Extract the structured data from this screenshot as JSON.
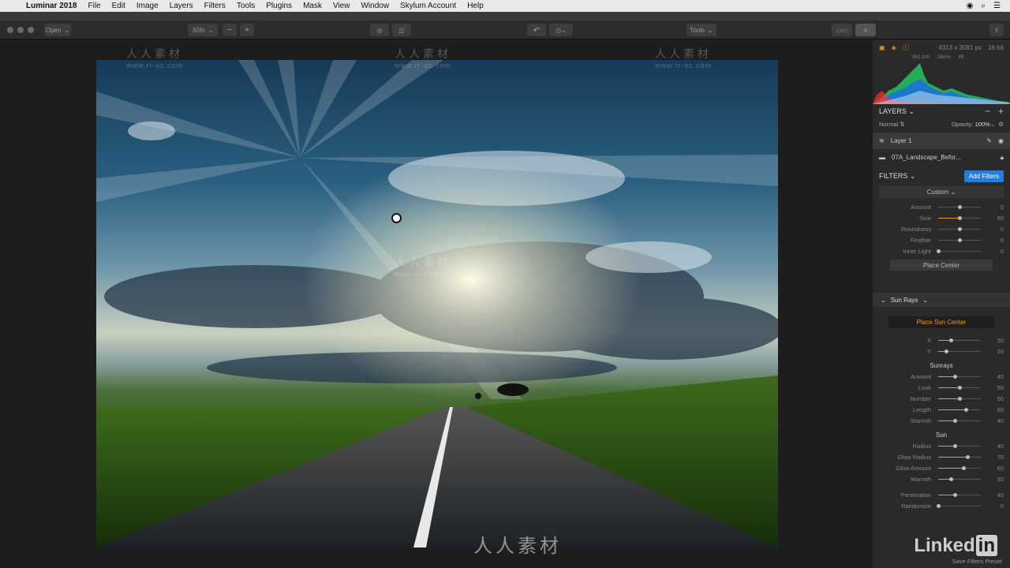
{
  "menubar": {
    "app": "Luminar 2018",
    "items": [
      "File",
      "Edit",
      "Image",
      "Layers",
      "Filters",
      "Tools",
      "Plugins",
      "Mask",
      "View",
      "Window",
      "Skylum Account",
      "Help"
    ]
  },
  "toolbar": {
    "open_label": "Open",
    "zoom_value": "30%",
    "tools_label": "Tools"
  },
  "histogram": {
    "size": "4313 x 3081 px",
    "bit": "16-bit",
    "iso": "ISO 100",
    "focal": "16mm",
    "aperture": "f/8"
  },
  "layers": {
    "title": "LAYERS",
    "blend": "Normal",
    "opacity_label": "Opacity:",
    "opacity_value": "100%",
    "items": [
      {
        "name": "Layer 1"
      },
      {
        "name": "07A_Landscape_Befor..."
      }
    ]
  },
  "filters": {
    "title": "FILTERS",
    "add_label": "Add Filters",
    "preset": "Custom",
    "top_sliders": [
      {
        "label": "Amount",
        "value": "0",
        "pos": 0.5,
        "fill": 0
      },
      {
        "label": "Size",
        "value": "50",
        "pos": 0.5,
        "fill": 0.5
      },
      {
        "label": "Roundness",
        "value": "0",
        "pos": 0.5,
        "fill": 0
      },
      {
        "label": "Feather",
        "value": "0",
        "pos": 0.5,
        "fill": 0
      },
      {
        "label": "Inner Light",
        "value": "0",
        "pos": 0.0,
        "fill": 0
      }
    ],
    "place_center": "Place Center",
    "sunrays_title": "Sun Rays",
    "place_sun_center": "Place Sun Center",
    "xy_sliders": [
      {
        "label": "X",
        "value": "30",
        "pos": 0.3,
        "fill": 0.3
      },
      {
        "label": "Y",
        "value": "20",
        "pos": 0.2,
        "fill": 0.2
      }
    ],
    "sunrays_label": "Sunrays",
    "sunrays_sliders": [
      {
        "label": "Amount",
        "value": "40",
        "pos": 0.4,
        "fill": 0.4
      },
      {
        "label": "Look",
        "value": "50",
        "pos": 0.5,
        "fill": 0.5
      },
      {
        "label": "Number",
        "value": "50",
        "pos": 0.5,
        "fill": 0.5
      },
      {
        "label": "Length",
        "value": "65",
        "pos": 0.65,
        "fill": 0.65
      },
      {
        "label": "Warmth",
        "value": "40",
        "pos": 0.4,
        "fill": 0.4
      }
    ],
    "sun_label": "Sun",
    "sun_sliders": [
      {
        "label": "Radius",
        "value": "40",
        "pos": 0.4,
        "fill": 0.4
      },
      {
        "label": "Glow Radius",
        "value": "70",
        "pos": 0.7,
        "fill": 0.7
      },
      {
        "label": "Glow Amount",
        "value": "60",
        "pos": 0.6,
        "fill": 0.6
      },
      {
        "label": "Warmth",
        "value": "30",
        "pos": 0.3,
        "fill": 0.3
      }
    ],
    "bottom_sliders": [
      {
        "label": "Penetration",
        "value": "40",
        "pos": 0.4,
        "fill": 0.4
      },
      {
        "label": "Randomize",
        "value": "0",
        "pos": 0.0,
        "fill": 0
      }
    ],
    "save_preset": "Save Filters Preset"
  },
  "watermark": {
    "cn": "人人素材",
    "url": "www.rr-sc.com"
  },
  "brand": {
    "linkedin_a": "Linked",
    "linkedin_b": "in"
  },
  "colors": {
    "accent": "#e0a020",
    "blue": "#2b7bd8"
  }
}
